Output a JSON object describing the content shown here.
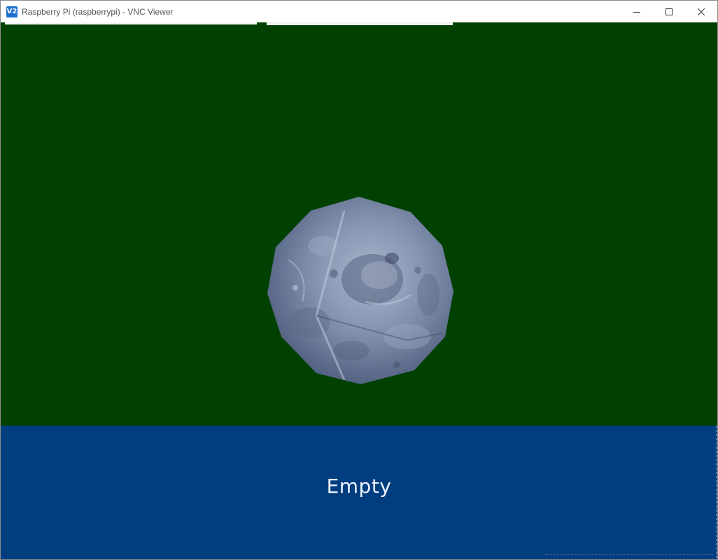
{
  "window": {
    "title": "Raspberry Pi (raspberrypi) - VNC Viewer",
    "app_icon": "vnc-viewer-icon",
    "app_icon_text": "V2",
    "controls": [
      "minimize-icon",
      "maximize-icon",
      "close-icon"
    ]
  },
  "viewer": {
    "background_color": "#004000",
    "object": "moon-sphere",
    "object_color": "#7f8da8"
  },
  "status_panel": {
    "background_color": "#003e80",
    "text": "Empty"
  }
}
